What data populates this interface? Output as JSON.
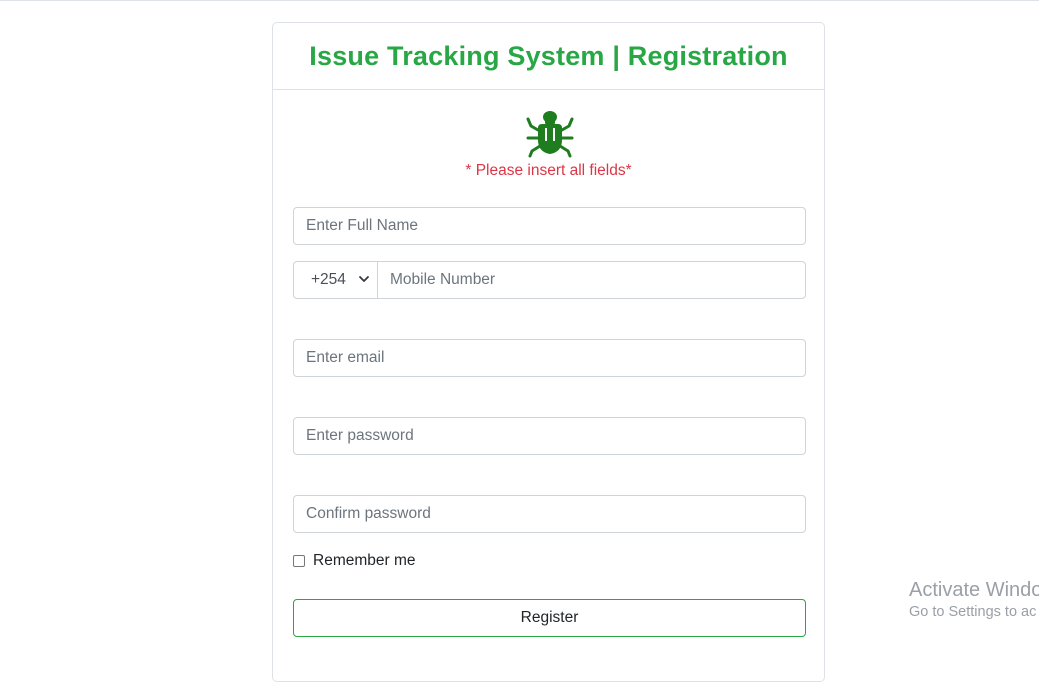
{
  "card": {
    "title": "Issue Tracking System | Registration",
    "logo_icon": "bug-icon",
    "notice": "* Please insert all fields*"
  },
  "form": {
    "full_name": {
      "placeholder": "Enter Full Name",
      "value": ""
    },
    "country_code": {
      "selected": "+254"
    },
    "mobile": {
      "placeholder": "Mobile Number",
      "value": ""
    },
    "email": {
      "placeholder": "Enter email",
      "value": ""
    },
    "password": {
      "placeholder": "Enter password",
      "value": ""
    },
    "confirm_password": {
      "placeholder": "Confirm password",
      "value": ""
    },
    "remember_label": "Remember me",
    "remember_checked": false,
    "register_label": "Register"
  },
  "watermark": {
    "title": "Activate Windo",
    "subtitle": "Go to Settings to ac"
  },
  "colors": {
    "accent": "#28a745",
    "logo": "#1e7d1e",
    "notice": "#dc3545",
    "border": "#ced4da"
  }
}
